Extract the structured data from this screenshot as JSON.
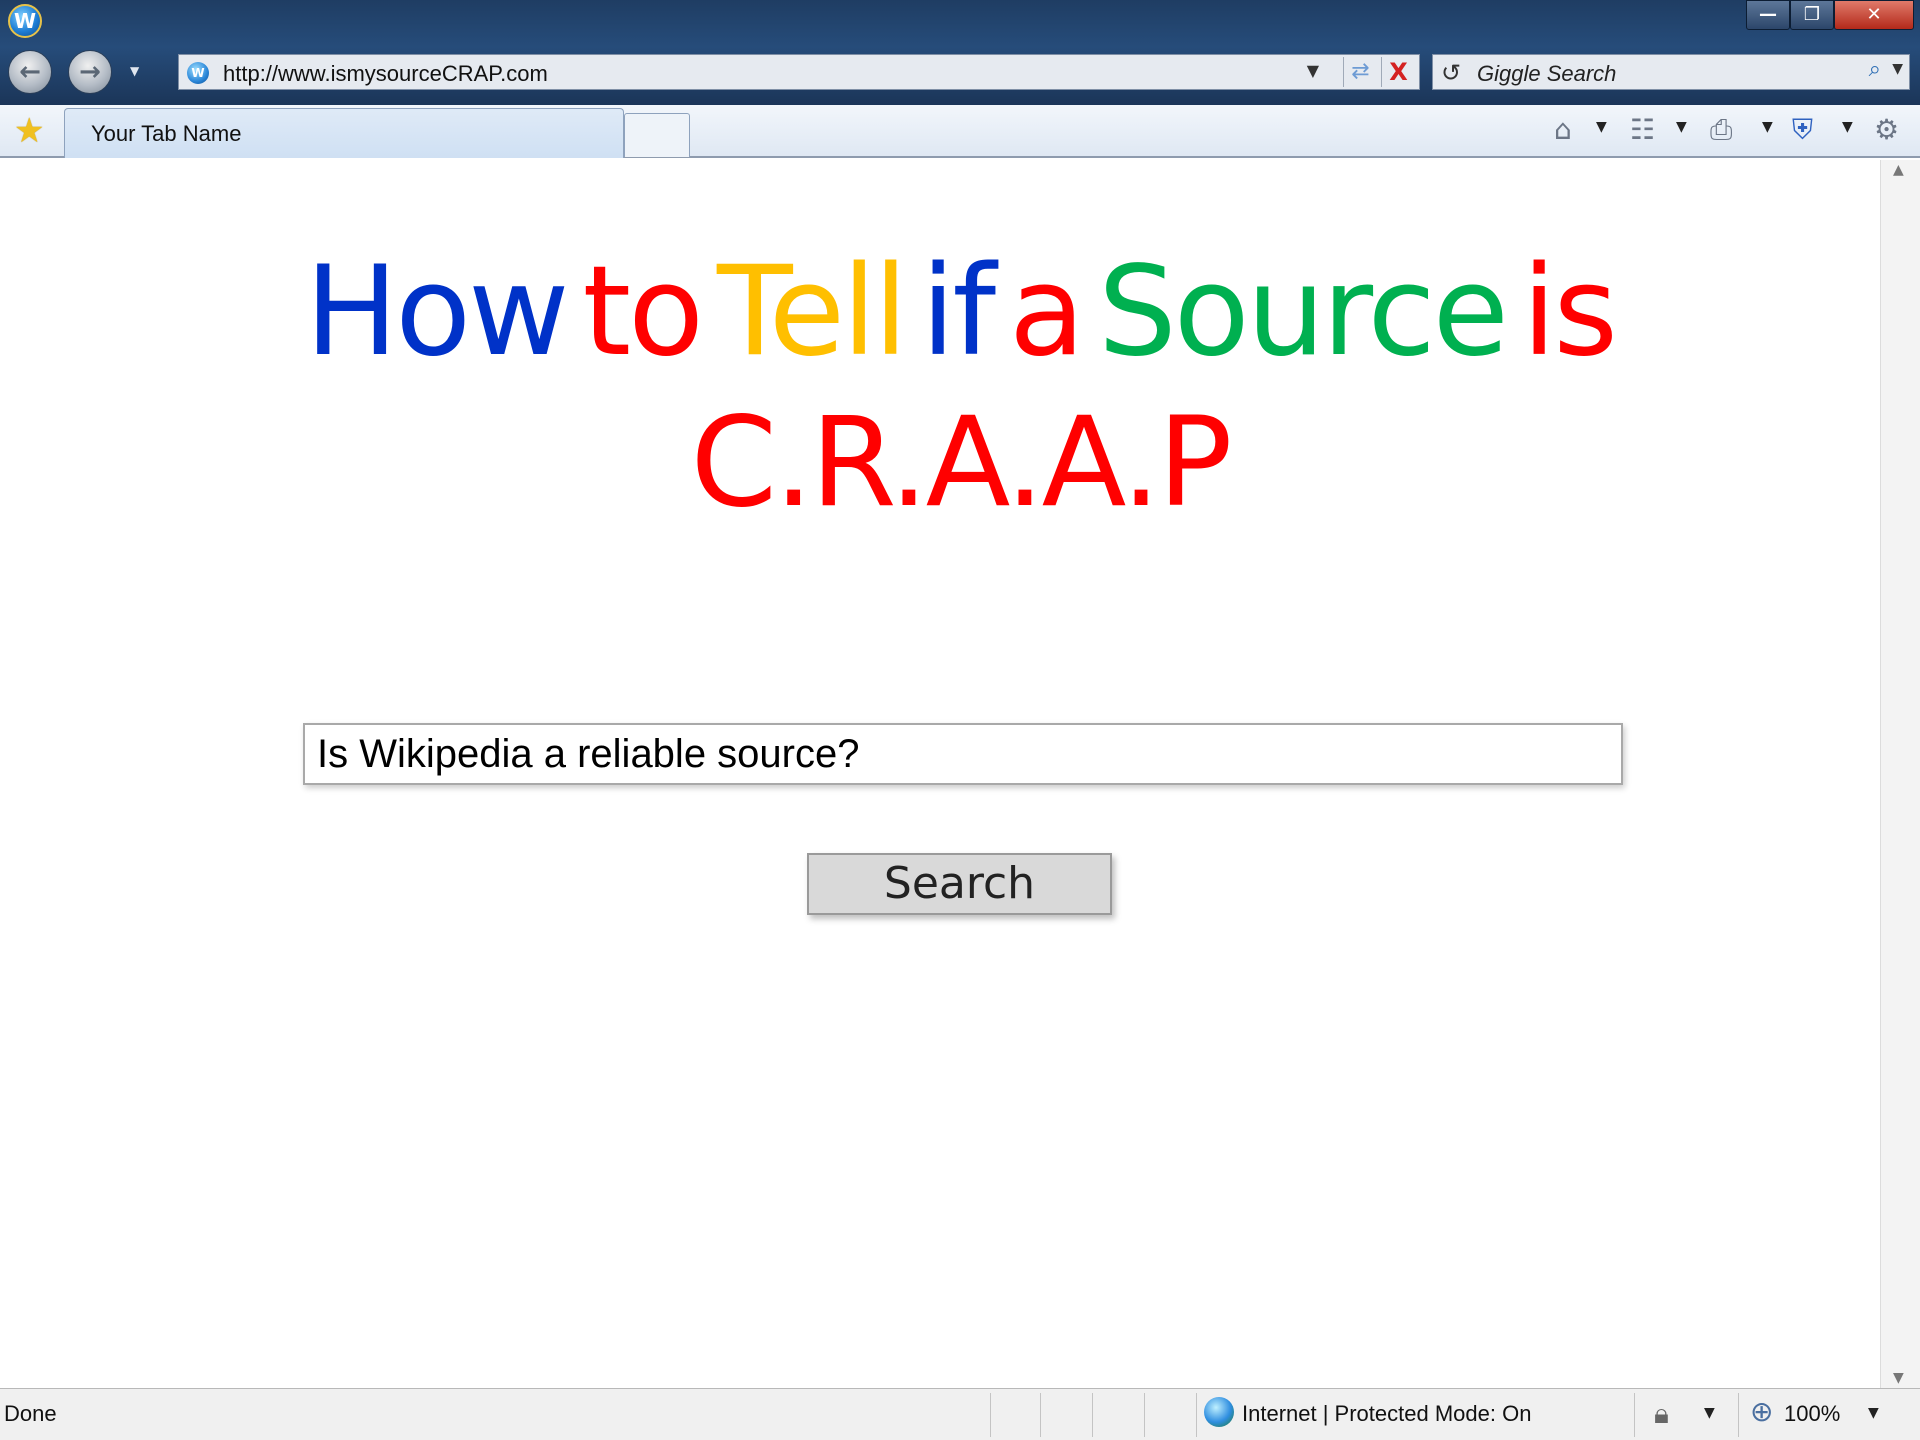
{
  "browser": {
    "app_logo_letter": "W",
    "window_buttons": {
      "minimize": "—",
      "restore": "❐",
      "close": "✕"
    },
    "address_url": "http://www.ismysourceCRAP.com",
    "search_provider": "Giggle Search",
    "tab_label": "Your Tab Name",
    "icons": {
      "back": "back-arrow-icon",
      "forward": "forward-arrow-icon",
      "refresh": "refresh-icon",
      "stop": "stop-icon",
      "favorites": "star-icon",
      "home": "home-icon",
      "feeds": "rss-icon",
      "print": "printer-icon",
      "safety": "shield-icon",
      "tools": "gear-icon"
    }
  },
  "page": {
    "headline_words": [
      {
        "text": "How",
        "color": "#0032c8"
      },
      {
        "text": "to",
        "color": "#ff0000"
      },
      {
        "text": "Tell",
        "color": "#ffbf00"
      },
      {
        "text": "if",
        "color": "#0032c8"
      },
      {
        "text": "a",
        "color": "#ff0000"
      },
      {
        "text": "Source",
        "color": "#00b050"
      },
      {
        "text": "is",
        "color": "#ff0000"
      }
    ],
    "headline_line2": {
      "text": "C.R.A.A.P",
      "color": "#ff0000"
    },
    "search_query": "Is Wikipedia a reliable source?",
    "search_button_label": "Search"
  },
  "statusbar": {
    "status_text": "Done",
    "zone_text": "Internet | Protected Mode: On",
    "zoom_text": "100%"
  }
}
